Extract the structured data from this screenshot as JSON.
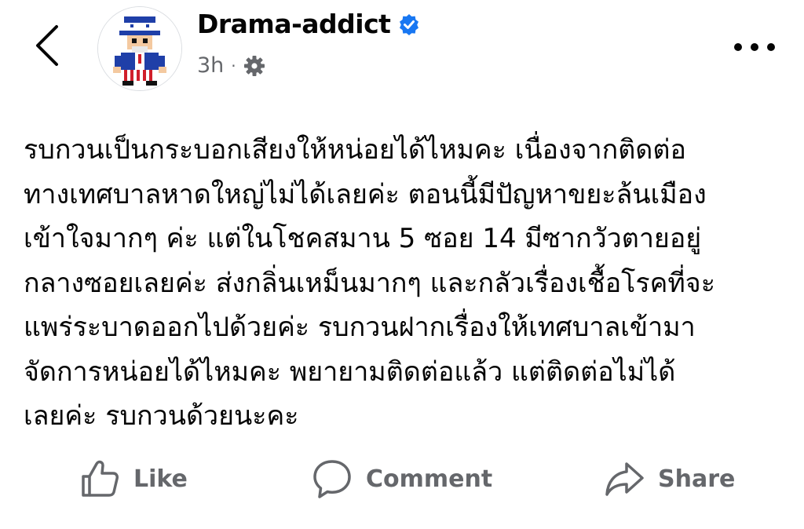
{
  "header": {
    "author_name": "Drama-addict",
    "timestamp": "3h",
    "separator": "·",
    "verified_icon": "verified-badge-icon",
    "privacy_icon": "gear-icon",
    "back_icon": "chevron-left-icon",
    "more_icon": "more-dots-icon"
  },
  "post": {
    "text": "รบกวนเป็นกระบอกเสียงให้หน่อยได้ไหมคะ เนื่องจากติดต่อ\nทางเทศบาลหาดใหญ่ไม่ได้เลยค่ะ  ตอนนี้มีปัญหาขยะล้นเมือง\nเข้าใจมากๆ ค่ะ  แต่ในโชคสมาน 5 ซอย 14 มีซากวัวตายอยู่\nกลางซอยเลยค่ะ ส่งกลิ่นเหม็นมากๆ และกลัวเรื่องเชื้อโรคที่จะ\nแพร่ระบาดออกไปด้วยค่ะ รบกวนฝากเรื่องให้เทศบาลเข้ามา\nจัดการหน่อยได้ไหมคะ พยายามติดต่อแล้ว แต่ติดต่อไม่ได้\nเลยค่ะ รบกวนด้วยนะคะ"
  },
  "actions": {
    "like_label": "Like",
    "comment_label": "Comment",
    "share_label": "Share"
  },
  "colors": {
    "text": "#050505",
    "secondary": "#65676b",
    "verified": "#1877f2"
  }
}
